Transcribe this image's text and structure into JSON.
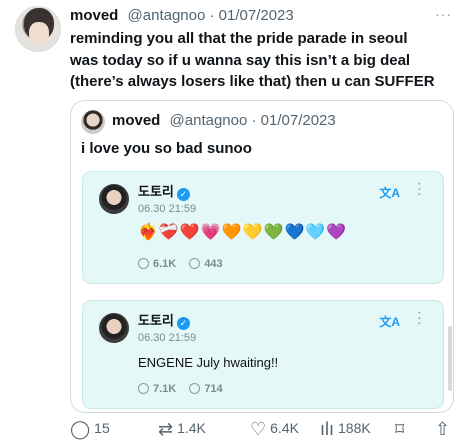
{
  "tweet": {
    "author_name": "moved",
    "author_handle": "@antagnoo · 01/07/2023",
    "text": "reminding you all that the pride parade in seoul\nwas today so if u wanna say this isn’t a big deal\n(there’s always losers like that) then u can SUFFER",
    "menu_icon": "more-dots-icon"
  },
  "quote": {
    "author_name": "moved",
    "author_handle": "@antagnoo · 01/07/2023",
    "text": "i love you so bad sunoo",
    "posts": [
      {
        "name": "도토리",
        "date": "06.30 21:59",
        "body": "❤️‍🔥❤️‍🩹❤️💗🧡💛💚💙🩵💜",
        "stats": {
          "reposts": "6.1K",
          "replies": "443"
        },
        "translate_icon": "translate-icon",
        "menu_icon": "vertical-more-icon"
      },
      {
        "name": "도토리",
        "date": "06.30 21:59",
        "body": "ENGENE July hwaiting!!",
        "stats": {
          "reposts": "7.1K",
          "replies": "714"
        },
        "translate_icon": "translate-icon",
        "menu_icon": "vertical-more-icon"
      }
    ]
  },
  "actions": {
    "replies": "15",
    "reposts": "1.4K",
    "likes": "6.4K",
    "views": "188K"
  },
  "colors": {
    "card_background": "#e4f8f8",
    "accent": "#1d9bf0",
    "muted": "#536471"
  }
}
